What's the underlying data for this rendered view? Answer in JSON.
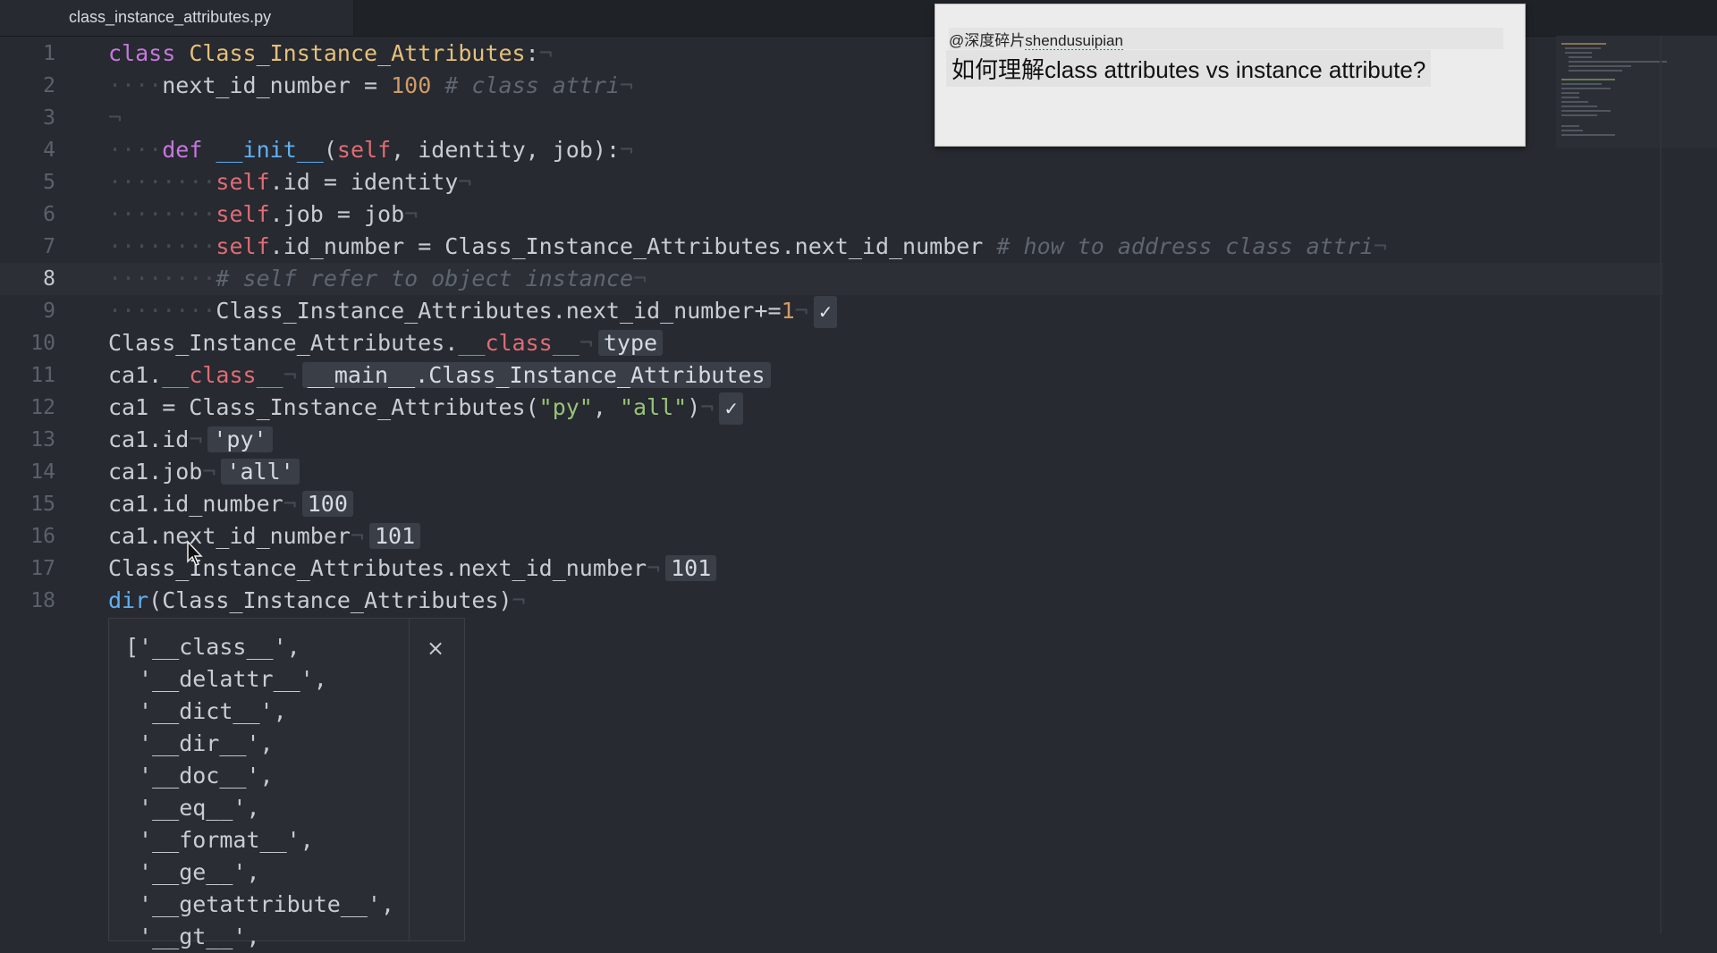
{
  "tab": {
    "title": "class_instance_attributes.py"
  },
  "editor": {
    "active_line": 8,
    "lines": [
      {
        "n": "1"
      },
      {
        "n": "2"
      },
      {
        "n": "3"
      },
      {
        "n": "4"
      },
      {
        "n": "5"
      },
      {
        "n": "6"
      },
      {
        "n": "7"
      },
      {
        "n": "8"
      },
      {
        "n": "9"
      },
      {
        "n": "10"
      },
      {
        "n": "11"
      },
      {
        "n": "12"
      },
      {
        "n": "13"
      },
      {
        "n": "14"
      },
      {
        "n": "15"
      },
      {
        "n": "16"
      },
      {
        "n": "17"
      },
      {
        "n": "18"
      }
    ],
    "code": {
      "l1": {
        "kw": "class",
        "name": "Class_Instance_Attributes",
        "colon": ":"
      },
      "l2": {
        "var": "next_id_number = ",
        "num": "100",
        "comment": "# class attri"
      },
      "l4": {
        "kw": "def",
        "fn": "__init__",
        "open": "(",
        "self": "self",
        "params": ", identity, job",
        "close": "):"
      },
      "l5": {
        "self": "self",
        "rest": ".id = identity"
      },
      "l6": {
        "self": "self",
        "rest": ".job = job"
      },
      "l7": {
        "self": "self",
        "rest": ".id_number = Class_Instance_Attributes.next_id_number",
        "comment": "# how to address class attri"
      },
      "l8": {
        "comment": "# self refer to object instance"
      },
      "l9": {
        "code": "Class_Instance_Attributes.next_id_number+=",
        "num": "1",
        "check": "✓"
      },
      "l10": {
        "code": "Class_Instance_Attributes.",
        "dunder": "__class__",
        "result": "type"
      },
      "l11": {
        "code": "ca1.",
        "dunder": "__class__",
        "result": "__main__.Class_Instance_Attributes"
      },
      "l12": {
        "code": "ca1 = Class_Instance_Attributes(",
        "s1": "\"py\"",
        "comma": ", ",
        "s2": "\"all\"",
        "close": ")",
        "check": "✓"
      },
      "l13": {
        "code": "ca1.id",
        "result": "'py'"
      },
      "l14": {
        "code": "ca1.job",
        "result": "'all'"
      },
      "l15": {
        "code": "ca1.id_number",
        "result": "100"
      },
      "l16": {
        "code": "ca1.next_id_number",
        "result": "101"
      },
      "l17": {
        "code": "Class_Instance_Attributes.next_id_number",
        "result": "101"
      },
      "l18": {
        "fn": "dir",
        "rest": "(Class_Instance_Attributes)"
      }
    }
  },
  "output_popup": {
    "close_label": "×",
    "items": [
      "['__class__',",
      " '__delattr__',",
      " '__dict__',",
      " '__dir__',",
      " '__doc__',",
      " '__eq__',",
      " '__format__',",
      " '__ge__',",
      " '__getattribute__',",
      " '__gt__',"
    ]
  },
  "caption": {
    "author_prefix": "@深度碎片",
    "author_handle": "shendusuipian",
    "text": "如何理解class attributes vs instance attribute?"
  },
  "colors": {
    "background": "#272a30",
    "keyword": "#c678dd",
    "class_name": "#e5c07b",
    "number": "#d19a66",
    "string": "#98c379",
    "function": "#61afef",
    "self": "#e06c75",
    "comment": "#5f6670"
  },
  "icons": {
    "close": "close-icon",
    "check": "checkmark-icon",
    "cursor": "mouse-pointer-icon"
  }
}
